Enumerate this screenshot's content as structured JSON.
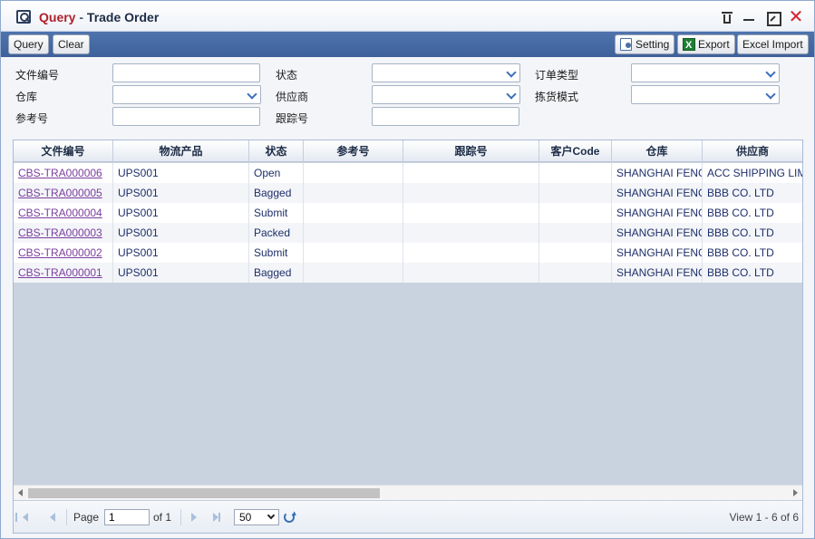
{
  "window": {
    "title_part1": "Query",
    "title_sep": " - ",
    "title_part2": "Trade Order"
  },
  "toolbar": {
    "query_label": "Query",
    "clear_label": "Clear",
    "setting_label": "Setting",
    "export_label": "Export",
    "excel_import_label": "Excel Import"
  },
  "form": {
    "doc_no_label": "文件编号",
    "status_label": "状态",
    "order_type_label": "订单类型",
    "warehouse_label": "仓库",
    "supplier_label": "供应商",
    "picking_mode_label": "拣货模式",
    "reference_label": "参考号",
    "tracking_label": "跟踪号",
    "doc_no_value": "",
    "reference_value": "",
    "tracking_value": ""
  },
  "grid": {
    "columns": [
      "文件编号",
      "物流产品",
      "状态",
      "参考号",
      "跟踪号",
      "客户Code",
      "仓库",
      "供应商"
    ],
    "rows": [
      {
        "doc_no": "CBS-TRA000006",
        "product": "UPS001",
        "status": "Open",
        "reference": "",
        "tracking": "",
        "customer_code": "",
        "warehouse": "SHANGHAI FENG",
        "supplier": "ACC SHIPPING LIMITED"
      },
      {
        "doc_no": "CBS-TRA000005",
        "product": "UPS001",
        "status": "Bagged",
        "reference": "",
        "tracking": "",
        "customer_code": "",
        "warehouse": "SHANGHAI FENG",
        "supplier": "BBB CO. LTD"
      },
      {
        "doc_no": "CBS-TRA000004",
        "product": "UPS001",
        "status": "Submit",
        "reference": "",
        "tracking": "",
        "customer_code": "",
        "warehouse": "SHANGHAI FENG",
        "supplier": "BBB CO. LTD"
      },
      {
        "doc_no": "CBS-TRA000003",
        "product": "UPS001",
        "status": "Packed",
        "reference": "",
        "tracking": "",
        "customer_code": "",
        "warehouse": "SHANGHAI FENG",
        "supplier": "BBB CO. LTD"
      },
      {
        "doc_no": "CBS-TRA000002",
        "product": "UPS001",
        "status": "Submit",
        "reference": "",
        "tracking": "",
        "customer_code": "",
        "warehouse": "SHANGHAI FENG",
        "supplier": "BBB CO. LTD"
      },
      {
        "doc_no": "CBS-TRA000001",
        "product": "UPS001",
        "status": "Bagged",
        "reference": "",
        "tracking": "",
        "customer_code": "",
        "warehouse": "SHANGHAI FENG",
        "supplier": "BBB CO. LTD"
      }
    ]
  },
  "pager": {
    "page_label": "Page",
    "page_value": "1",
    "of_label": "of 1",
    "page_size": "50",
    "view_text": "View 1 - 6 of 6"
  },
  "icons": {
    "app": "query-window-icon",
    "trash": "trash-icon",
    "minimize": "minimize-icon",
    "maximize": "maximize-icon",
    "close": "close-icon",
    "setting": "setting-icon",
    "export": "excel-export-icon",
    "refresh": "refresh-icon"
  },
  "colors": {
    "title_accent": "#b0202a",
    "toolbar_bg": "#4a6fa8",
    "link": "#7a3e9d",
    "close": "#d7212b"
  }
}
